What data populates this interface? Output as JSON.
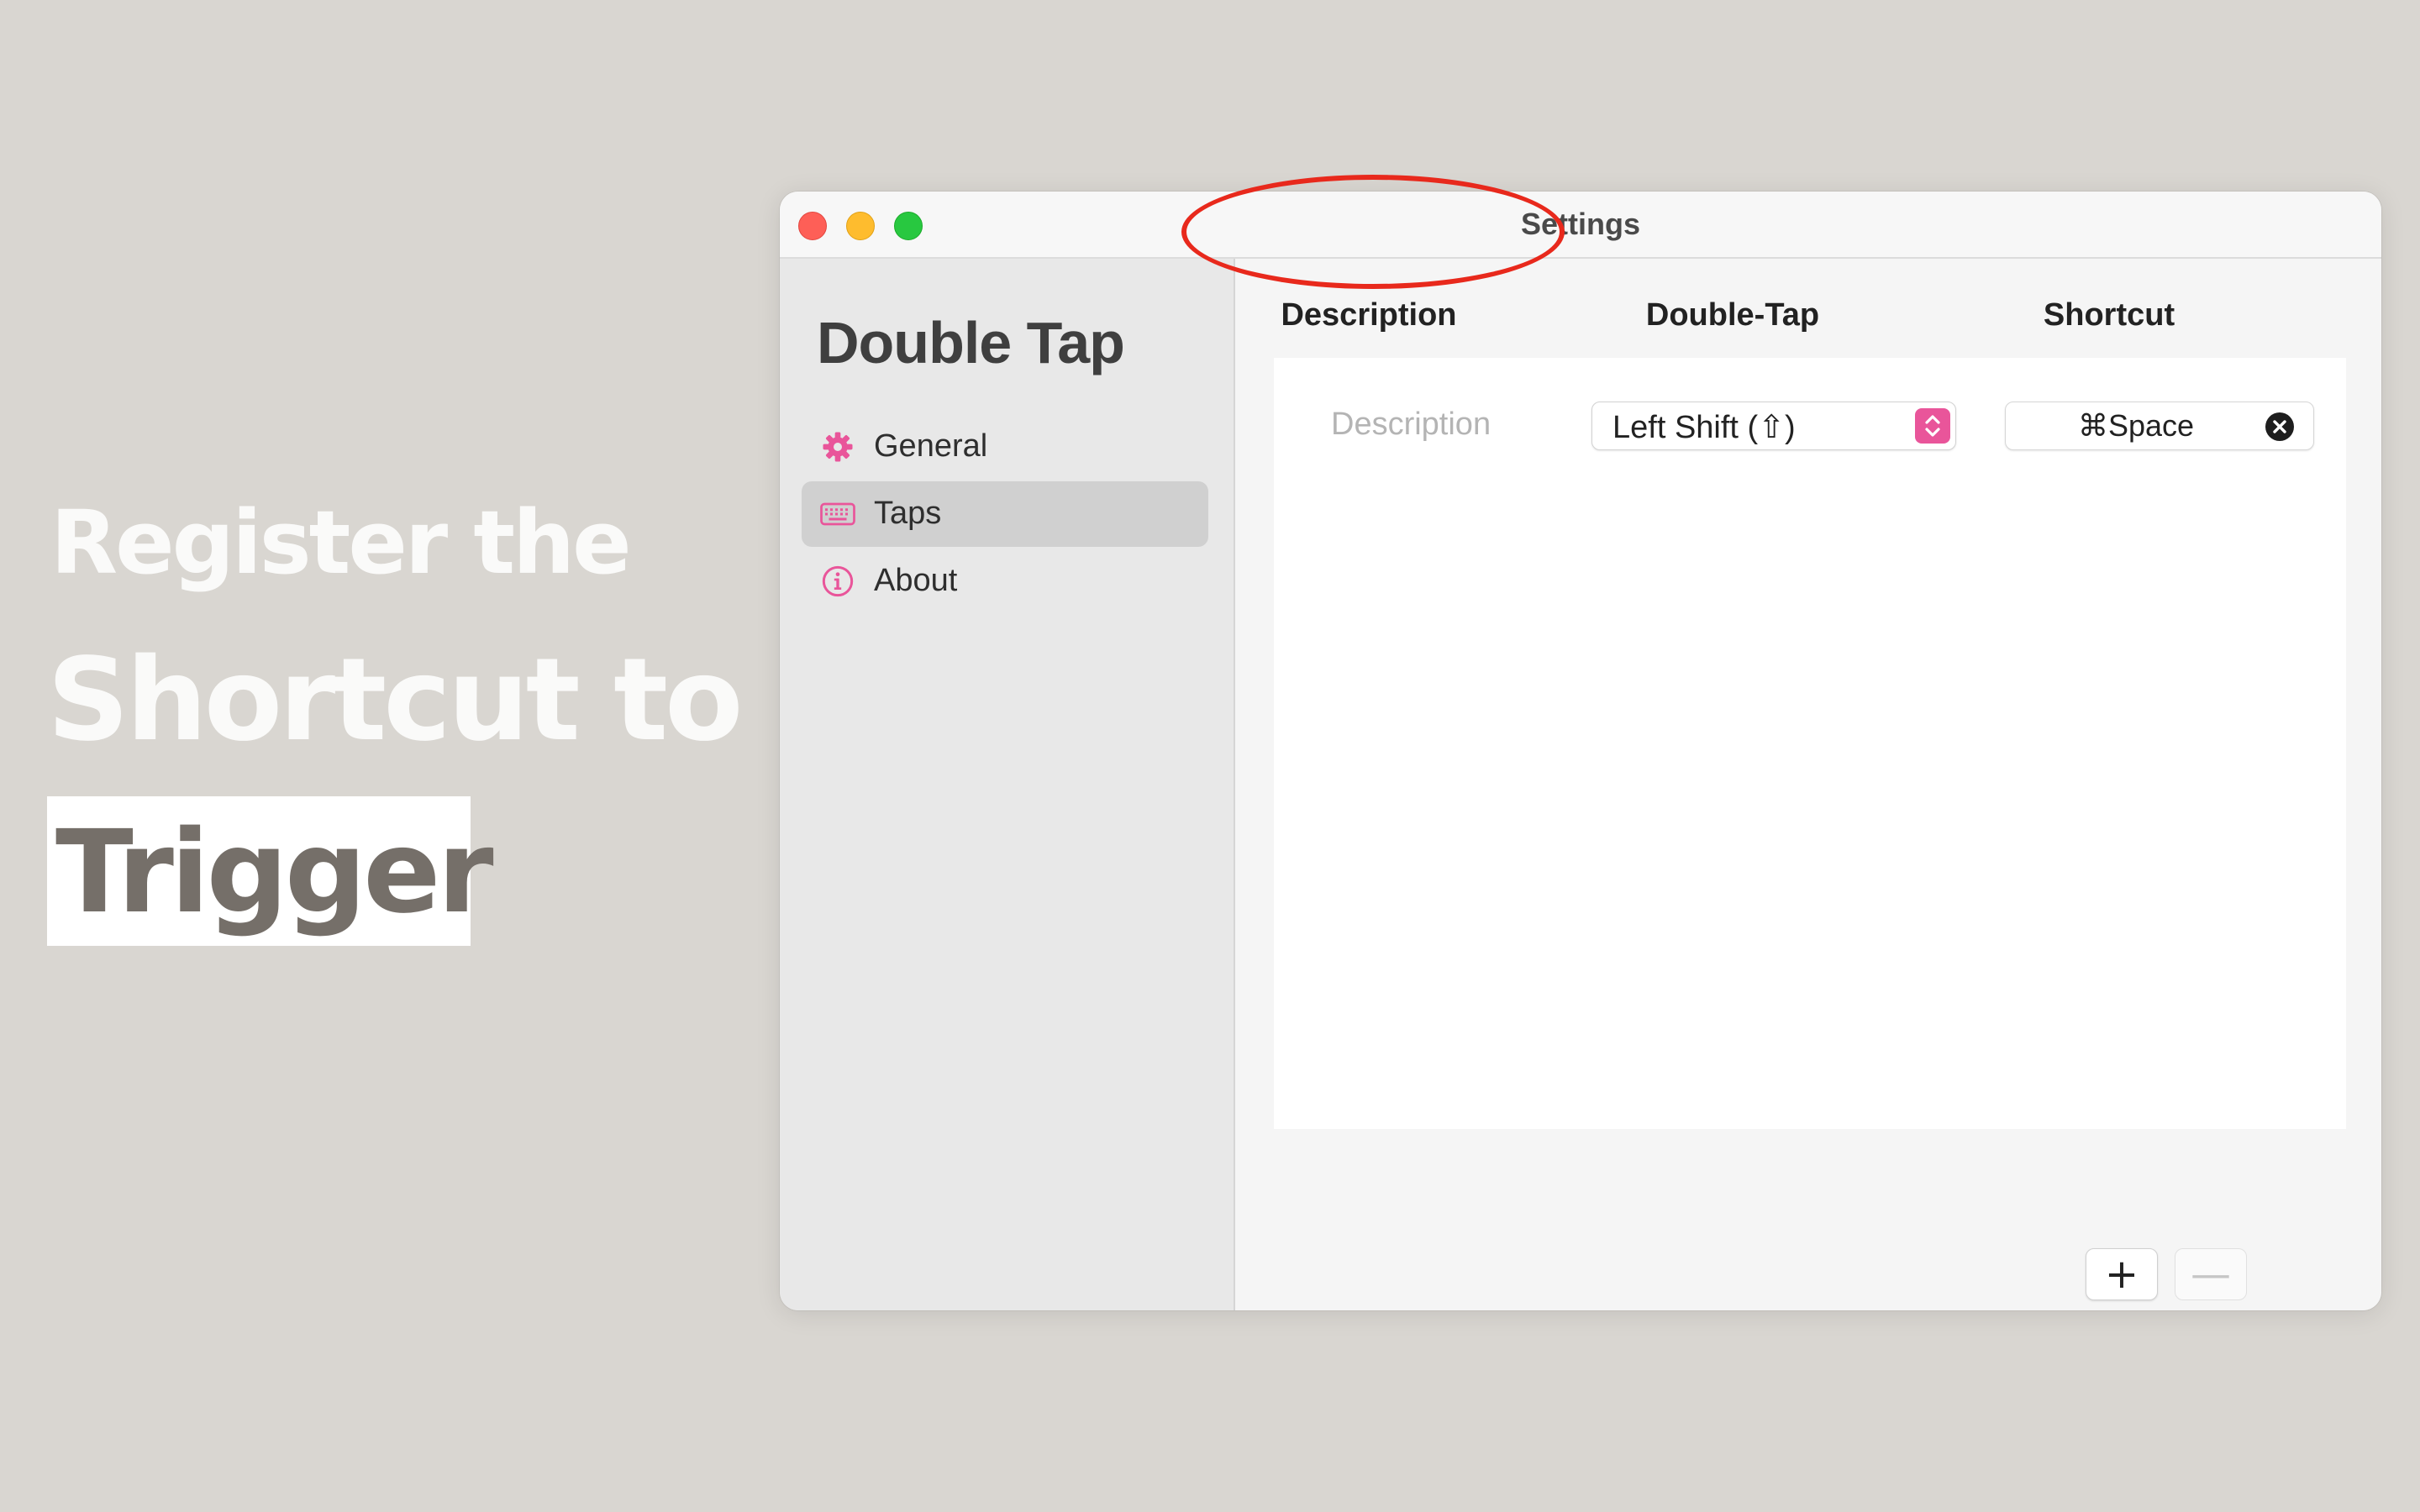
{
  "headline": {
    "line1": "Register the",
    "line2": "Shortcut to",
    "line3": "Trigger"
  },
  "window": {
    "title": "Settings"
  },
  "sidebar": {
    "app_name": "Double Tap",
    "items": [
      {
        "label": "General",
        "icon": "gear-icon"
      },
      {
        "label": "Taps",
        "icon": "keyboard-icon",
        "selected": true
      },
      {
        "label": "About",
        "icon": "info-icon"
      }
    ]
  },
  "table": {
    "columns": [
      "Description",
      "Double-Tap",
      "Shortcut"
    ],
    "rows": [
      {
        "description_placeholder": "Description",
        "double_tap": "Left Shift (⇧)",
        "shortcut": "⌘Space"
      }
    ]
  },
  "buttons": {
    "add": "+",
    "remove": "—"
  },
  "colors": {
    "background": "#d9d6d1",
    "accent": "#e9559a",
    "highlight_ring": "#e8291c",
    "headline_text": "#fafaf9",
    "trigger_text": "#756f69"
  }
}
